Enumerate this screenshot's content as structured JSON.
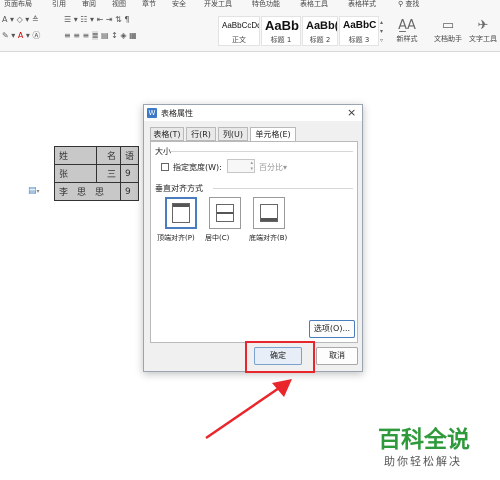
{
  "ribbon": {
    "tabs": [
      "页面布局",
      "引用",
      "审阅",
      "视图",
      "章节",
      "安全",
      "开发工具",
      "特色功能",
      "表格工具",
      "表格样式"
    ],
    "search": "查找",
    "styles": [
      {
        "preview": "AaBbCcDd",
        "name": "正文"
      },
      {
        "preview": "AaBb",
        "name": "标题 1"
      },
      {
        "preview": "AaBb(",
        "name": "标题 2"
      },
      {
        "preview": "AaBbC",
        "name": "标题 3"
      }
    ],
    "new_style": "新样式",
    "assistant": "文档助手",
    "text_tools": "文字工具"
  },
  "document": {
    "rows": [
      [
        "姓",
        "名",
        "语"
      ],
      [
        "张",
        "三",
        "9"
      ],
      [
        "李　思　思",
        "",
        "9"
      ]
    ]
  },
  "dialog": {
    "title": "表格属性",
    "close": "×",
    "tabs": [
      "表格(T)",
      "行(R)",
      "列(U)",
      "单元格(E)"
    ],
    "active_tab": 3,
    "size_section": "大小",
    "specify_width_label": "指定宽度(W):",
    "width_value": "",
    "unit": "百分比",
    "valign_section": "垂直对齐方式",
    "align_options": [
      "顶端对齐(P)",
      "居中(C)",
      "底端对齐(B)"
    ],
    "selected_align": 0,
    "options_button": "选项(O)...",
    "ok_button": "确定",
    "cancel_button": "取消"
  },
  "watermark": {
    "title": "百科全说",
    "subtitle": "助你轻松解决"
  },
  "colors": {
    "highlight": "#e8262b",
    "arrow": "#e8262b",
    "watermark_green": "#2f9a3b",
    "selected_border": "#4a7dbd"
  }
}
